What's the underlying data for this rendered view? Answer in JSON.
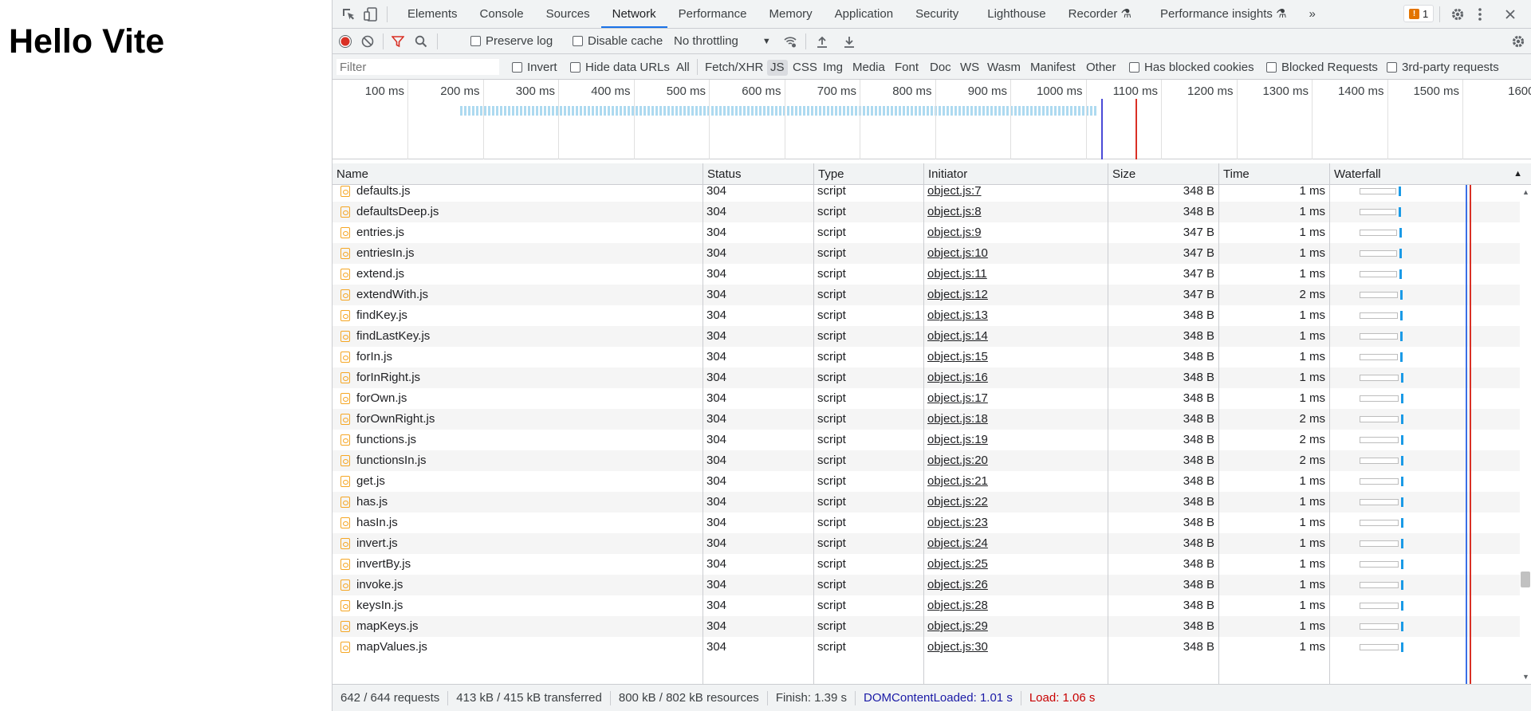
{
  "page": {
    "title": "Hello Vite"
  },
  "devtools": {
    "tabs": [
      "Elements",
      "Console",
      "Sources",
      "Network",
      "Performance",
      "Memory",
      "Application",
      "Security",
      "Lighthouse",
      "Recorder",
      "Performance insights"
    ],
    "active_tab": "Network",
    "issues_count": "1",
    "toolbar": {
      "preserve_log": "Preserve log",
      "disable_cache": "Disable cache",
      "throttling": "No throttling"
    },
    "filterbar": {
      "filter_placeholder": "Filter",
      "invert": "Invert",
      "hide_data_urls": "Hide data URLs",
      "types": [
        "All",
        "Fetch/XHR",
        "JS",
        "CSS",
        "Img",
        "Media",
        "Font",
        "Doc",
        "WS",
        "Wasm",
        "Manifest",
        "Other"
      ],
      "active_type": "JS",
      "has_blocked_cookies": "Has blocked cookies",
      "blocked_requests": "Blocked Requests",
      "third_party": "3rd-party requests"
    },
    "overview_ticks": [
      "100 ms",
      "200 ms",
      "300 ms",
      "400 ms",
      "500 ms",
      "600 ms",
      "700 ms",
      "800 ms",
      "900 ms",
      "1000 ms",
      "1100 ms",
      "1200 ms",
      "1300 ms",
      "1400 ms",
      "1500 ms",
      "1600"
    ],
    "columns": [
      "Name",
      "Status",
      "Type",
      "Initiator",
      "Size",
      "Time",
      "Waterfall"
    ],
    "rows": [
      {
        "name": "defaults.js",
        "status": "304",
        "type": "script",
        "initiator": "object.js:7",
        "size": "348 B",
        "time": "1 ms"
      },
      {
        "name": "defaultsDeep.js",
        "status": "304",
        "type": "script",
        "initiator": "object.js:8",
        "size": "348 B",
        "time": "1 ms"
      },
      {
        "name": "entries.js",
        "status": "304",
        "type": "script",
        "initiator": "object.js:9",
        "size": "347 B",
        "time": "1 ms"
      },
      {
        "name": "entriesIn.js",
        "status": "304",
        "type": "script",
        "initiator": "object.js:10",
        "size": "347 B",
        "time": "1 ms"
      },
      {
        "name": "extend.js",
        "status": "304",
        "type": "script",
        "initiator": "object.js:11",
        "size": "347 B",
        "time": "1 ms"
      },
      {
        "name": "extendWith.js",
        "status": "304",
        "type": "script",
        "initiator": "object.js:12",
        "size": "347 B",
        "time": "2 ms"
      },
      {
        "name": "findKey.js",
        "status": "304",
        "type": "script",
        "initiator": "object.js:13",
        "size": "348 B",
        "time": "1 ms"
      },
      {
        "name": "findLastKey.js",
        "status": "304",
        "type": "script",
        "initiator": "object.js:14",
        "size": "348 B",
        "time": "1 ms"
      },
      {
        "name": "forIn.js",
        "status": "304",
        "type": "script",
        "initiator": "object.js:15",
        "size": "348 B",
        "time": "1 ms"
      },
      {
        "name": "forInRight.js",
        "status": "304",
        "type": "script",
        "initiator": "object.js:16",
        "size": "348 B",
        "time": "1 ms"
      },
      {
        "name": "forOwn.js",
        "status": "304",
        "type": "script",
        "initiator": "object.js:17",
        "size": "348 B",
        "time": "1 ms"
      },
      {
        "name": "forOwnRight.js",
        "status": "304",
        "type": "script",
        "initiator": "object.js:18",
        "size": "348 B",
        "time": "2 ms"
      },
      {
        "name": "functions.js",
        "status": "304",
        "type": "script",
        "initiator": "object.js:19",
        "size": "348 B",
        "time": "2 ms"
      },
      {
        "name": "functionsIn.js",
        "status": "304",
        "type": "script",
        "initiator": "object.js:20",
        "size": "348 B",
        "time": "2 ms"
      },
      {
        "name": "get.js",
        "status": "304",
        "type": "script",
        "initiator": "object.js:21",
        "size": "348 B",
        "time": "1 ms"
      },
      {
        "name": "has.js",
        "status": "304",
        "type": "script",
        "initiator": "object.js:22",
        "size": "348 B",
        "time": "1 ms"
      },
      {
        "name": "hasIn.js",
        "status": "304",
        "type": "script",
        "initiator": "object.js:23",
        "size": "348 B",
        "time": "1 ms"
      },
      {
        "name": "invert.js",
        "status": "304",
        "type": "script",
        "initiator": "object.js:24",
        "size": "348 B",
        "time": "1 ms"
      },
      {
        "name": "invertBy.js",
        "status": "304",
        "type": "script",
        "initiator": "object.js:25",
        "size": "348 B",
        "time": "1 ms"
      },
      {
        "name": "invoke.js",
        "status": "304",
        "type": "script",
        "initiator": "object.js:26",
        "size": "348 B",
        "time": "1 ms"
      },
      {
        "name": "keysIn.js",
        "status": "304",
        "type": "script",
        "initiator": "object.js:28",
        "size": "348 B",
        "time": "1 ms"
      },
      {
        "name": "mapKeys.js",
        "status": "304",
        "type": "script",
        "initiator": "object.js:29",
        "size": "348 B",
        "time": "1 ms"
      },
      {
        "name": "mapValues.js",
        "status": "304",
        "type": "script",
        "initiator": "object.js:30",
        "size": "348 B",
        "time": "1 ms"
      }
    ],
    "status": {
      "requests": "642 / 644 requests",
      "transferred": "413 kB / 415 kB transferred",
      "resources": "800 kB / 802 kB resources",
      "finish": "Finish: 1.39 s",
      "dom_content_loaded": "DOMContentLoaded: 1.01 s",
      "load": "Load: 1.06 s"
    },
    "colors": {
      "accent": "#1a73e8",
      "dcl": "#1a1aa6",
      "load": "#c80000",
      "record": "#d93025"
    }
  }
}
